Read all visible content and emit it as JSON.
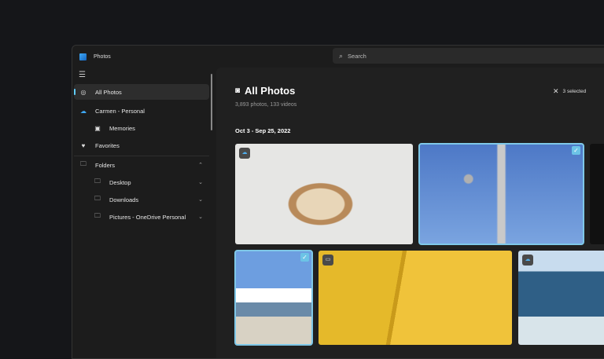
{
  "app": {
    "title": "Photos"
  },
  "search": {
    "placeholder": "Search"
  },
  "sidebar": {
    "items": [
      {
        "label": "All Photos",
        "icon": "photos-icon"
      },
      {
        "label": "Carmen - Personal",
        "icon": "onedrive-cloud-icon"
      },
      {
        "label": "Memories",
        "icon": "memories-icon"
      },
      {
        "label": "Favorites",
        "icon": "heart-icon"
      },
      {
        "label": "Folders",
        "icon": "folder-icon"
      },
      {
        "label": "Desktop",
        "icon": "folder-icon"
      },
      {
        "label": "Downloads",
        "icon": "folder-icon"
      },
      {
        "label": "Pictures - OneDrive Personal",
        "icon": "folder-icon"
      }
    ]
  },
  "main": {
    "title": "All Photos",
    "subtitle": "3,893 photos, 133 videos",
    "selection": "3 selected",
    "date_group": "Oct 3 - Sep 25, 2022"
  },
  "colors": {
    "accent": "#60cdff",
    "selection": "#7fc8e8"
  }
}
